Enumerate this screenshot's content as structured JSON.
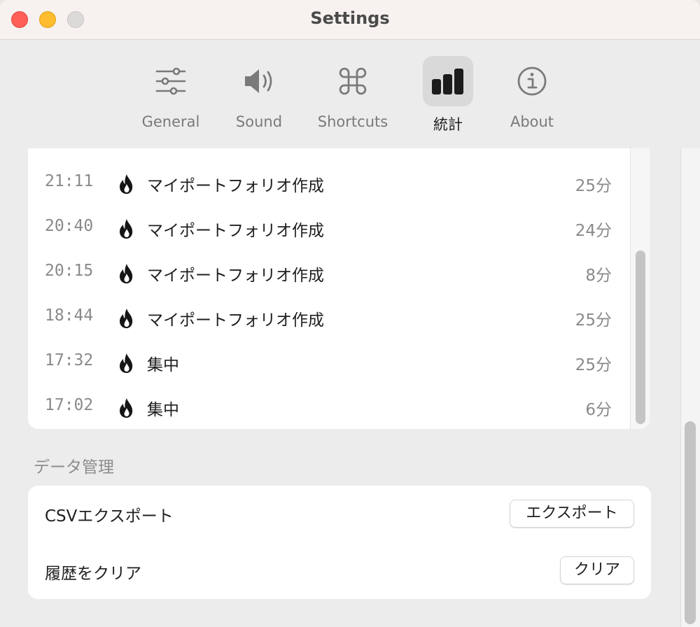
{
  "window": {
    "title": "Settings"
  },
  "tabs": [
    {
      "label": "General",
      "icon": "sliders-icon"
    },
    {
      "label": "Sound",
      "icon": "speaker-icon"
    },
    {
      "label": "Shortcuts",
      "icon": "command-icon"
    },
    {
      "label": "統計",
      "icon": "bar-chart-icon",
      "selected": true
    },
    {
      "label": "About",
      "icon": "info-icon"
    }
  ],
  "history": [
    {
      "time": "21:11",
      "task": "マイポートフォリオ作成",
      "duration": "25分"
    },
    {
      "time": "20:40",
      "task": "マイポートフォリオ作成",
      "duration": "24分"
    },
    {
      "time": "20:15",
      "task": "マイポートフォリオ作成",
      "duration": "8分"
    },
    {
      "time": "18:44",
      "task": "マイポートフォリオ作成",
      "duration": "25分"
    },
    {
      "time": "17:32",
      "task": "集中",
      "duration": "25分"
    },
    {
      "time": "17:02",
      "task": "集中",
      "duration": "6分"
    }
  ],
  "data_management": {
    "section_title": "データ管理",
    "csv_label": "CSVエクスポート",
    "export_button": "エクスポート",
    "clear_label": "履歴をクリア",
    "clear_button": "クリア"
  },
  "colors": {
    "close": "#ff5f57",
    "minimize": "#febc2e",
    "zoom": "#dcdad8",
    "selected_tab_bg": "#d9d9d9"
  }
}
